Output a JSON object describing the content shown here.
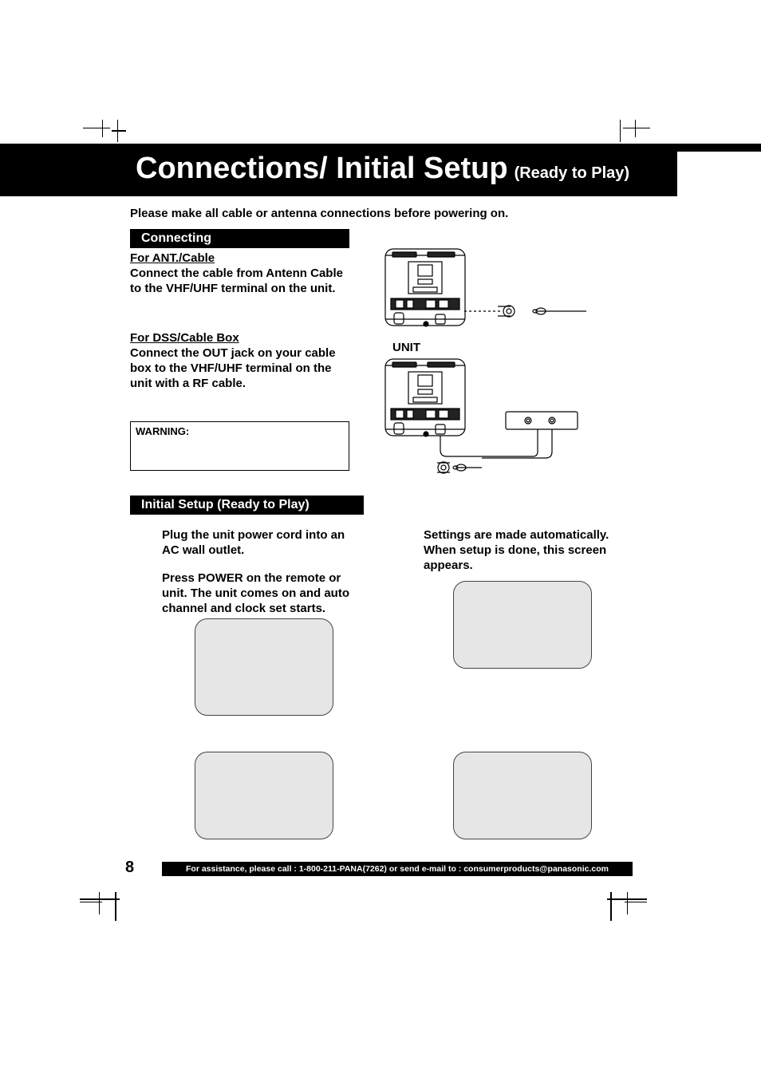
{
  "title": {
    "main": "Connections/ Initial Setup",
    "suffix": "(Ready to Play)"
  },
  "intro": "Please make all cable or antenna connections before powering on.",
  "sections": {
    "connecting_label": "Connecting",
    "initial_label": "Initial Setup (Ready to Play)"
  },
  "connecting": {
    "ant": {
      "heading": "For ANT./Cable",
      "body": "Connect the cable from Antenn Cable to the VHF/UHF terminal on the unit."
    },
    "dss": {
      "heading": "For DSS/Cable Box",
      "body": "Connect the OUT jack on your cable box to the VHF/UHF terminal on the unit with a RF cable."
    },
    "warning_label": "WARNING:",
    "unit_label": "UNIT"
  },
  "initial": {
    "step1": "Plug the unit power cord into an AC wall outlet.",
    "step2": "Press POWER on the remote or unit. The unit comes on and auto channel and clock set starts.",
    "step3": "Settings are made automatically. When setup is done, this screen appears."
  },
  "footer": {
    "page": "8",
    "text": "For assistance, please call : 1-800-211-PANA(7262) or send e-mail to : consumerproducts@panasonic.com"
  }
}
